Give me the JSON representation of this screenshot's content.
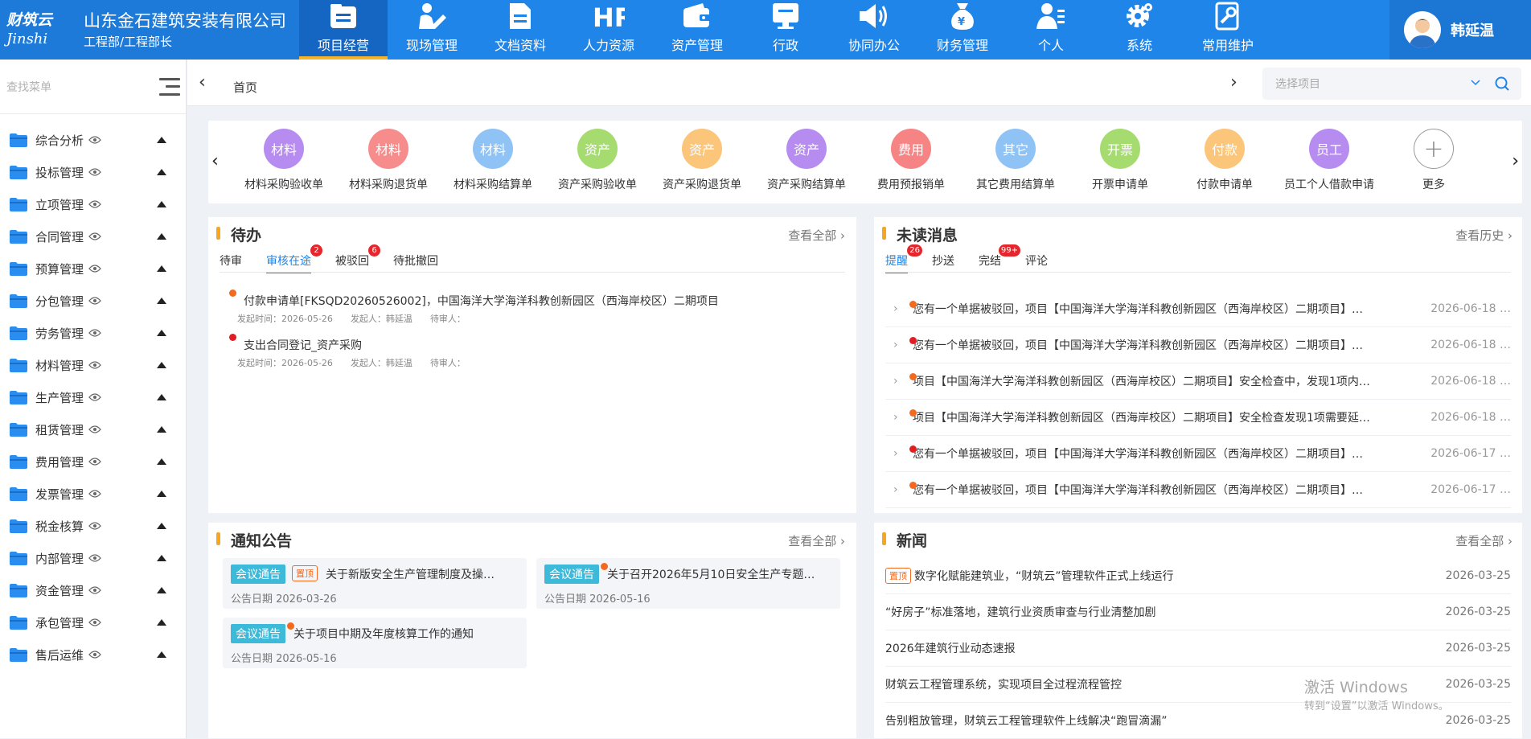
{
  "brand": {
    "logo_line1": "财筑云",
    "logo_line2": "Jinshi",
    "company": "山东金石建筑安装有限公司",
    "role": "工程部/工程部长"
  },
  "nav": [
    {
      "label": "项目经营",
      "icon": "project-icon",
      "active": true
    },
    {
      "label": "现场管理",
      "icon": "site-worker-icon"
    },
    {
      "label": "文档资料",
      "icon": "document-icon"
    },
    {
      "label": "人力资源",
      "icon": "hr-icon"
    },
    {
      "label": "资产管理",
      "icon": "wallet-icon"
    },
    {
      "label": "行政",
      "icon": "monitor-icon"
    },
    {
      "label": "协同办公",
      "icon": "speaker-icon"
    },
    {
      "label": "财务管理",
      "icon": "money-bag-icon"
    },
    {
      "label": "个人",
      "icon": "person-icon"
    },
    {
      "label": "系统",
      "icon": "gear-icon"
    },
    {
      "label": "常用维护",
      "icon": "maintenance-icon"
    }
  ],
  "user": {
    "name": "韩延温"
  },
  "sidebar": {
    "search_placeholder": "查找菜单",
    "items": [
      {
        "label": "综合分析"
      },
      {
        "label": "投标管理"
      },
      {
        "label": "立项管理"
      },
      {
        "label": "合同管理"
      },
      {
        "label": "预算管理"
      },
      {
        "label": "分包管理"
      },
      {
        "label": "劳务管理"
      },
      {
        "label": "材料管理"
      },
      {
        "label": "生产管理"
      },
      {
        "label": "租赁管理"
      },
      {
        "label": "费用管理"
      },
      {
        "label": "发票管理"
      },
      {
        "label": "税金核算"
      },
      {
        "label": "内部管理"
      },
      {
        "label": "资金管理"
      },
      {
        "label": "承包管理"
      },
      {
        "label": "售后运维"
      }
    ]
  },
  "breadcrumb": {
    "home": "首页",
    "project_placeholder": "选择项目"
  },
  "quick": [
    {
      "circle": "材料",
      "label": "材料采购验收单",
      "color": "#b78cf0"
    },
    {
      "circle": "材料",
      "label": "材料采购退货单",
      "color": "#f78c8c"
    },
    {
      "circle": "材料",
      "label": "材料采购结算单",
      "color": "#8fc3f5"
    },
    {
      "circle": "资产",
      "label": "资产采购验收单",
      "color": "#a6dc6f"
    },
    {
      "circle": "资产",
      "label": "资产采购退货单",
      "color": "#fbc57a"
    },
    {
      "circle": "资产",
      "label": "资产采购结算单",
      "color": "#b78cf0"
    },
    {
      "circle": "费用",
      "label": "费用预报销单",
      "color": "#f78484"
    },
    {
      "circle": "其它",
      "label": "其它费用结算单",
      "color": "#8fc3f5"
    },
    {
      "circle": "开票",
      "label": "开票申请单",
      "color": "#a6dc6f"
    },
    {
      "circle": "付款",
      "label": "付款申请单",
      "color": "#fbc57a"
    },
    {
      "circle": "员工",
      "label": "员工个人借款申请",
      "color": "#b78cf0"
    },
    {
      "circle": "+",
      "label": "更多",
      "color": "#ffffff"
    }
  ],
  "todo": {
    "title": "待办",
    "view_all": "查看全部",
    "tabs": [
      {
        "label": "待审"
      },
      {
        "label": "审核在途",
        "badge": "2",
        "active": true
      },
      {
        "label": "被驳回",
        "badge": "6"
      },
      {
        "label": "待批撤回"
      }
    ],
    "items": [
      {
        "title": "付款申请单[FKSQD20260526002]，中国海洋大学海洋科教创新园区（西海岸校区）二期项目",
        "time": "发起时间：2026-05-26",
        "initiator": "发起人：韩延温",
        "approver": "待审人：",
        "dot": "orange"
      },
      {
        "title": "支出合同登记_资产采购",
        "time": "发起时间：2026-05-26",
        "initiator": "发起人：韩延温",
        "approver": "待审人：",
        "dot": "red"
      }
    ]
  },
  "messages": {
    "title": "未读消息",
    "view_all": "查看历史",
    "tabs": [
      {
        "label": "提醒",
        "badge": "26",
        "active": true
      },
      {
        "label": "抄送"
      },
      {
        "label": "完结",
        "badge": "99+"
      },
      {
        "label": "评论"
      }
    ],
    "items": [
      {
        "text": "您有一个单据被驳回，项目【中国海洋大学海洋科教创新园区（西海岸校区）二期项目】…",
        "date": "2026-06-18 …",
        "dot": "orange"
      },
      {
        "text": "您有一个单据被驳回，项目【中国海洋大学海洋科教创新园区（西海岸校区）二期项目】…",
        "date": "2026-06-18 …",
        "dot": "red"
      },
      {
        "text": "项目【中国海洋大学海洋科教创新园区（西海岸校区）二期项目】安全检查中，发现1项内…",
        "date": "2026-06-18 …",
        "dot": "orange"
      },
      {
        "text": "项目【中国海洋大学海洋科教创新园区（西海岸校区）二期项目】安全检查发现1项需要延…",
        "date": "2026-06-18 …",
        "dot": "orange"
      },
      {
        "text": "您有一个单据被驳回，项目【中国海洋大学海洋科教创新园区（西海岸校区）二期项目】…",
        "date": "2026-06-17 …",
        "dot": "red"
      },
      {
        "text": "您有一个单据被驳回，项目【中国海洋大学海洋科教创新园区（西海岸校区）二期项目】…",
        "date": "2026-06-17 …",
        "dot": "orange"
      }
    ]
  },
  "notices": {
    "title": "通知公告",
    "view_all": "查看全部",
    "items": [
      {
        "tag": "会议通告",
        "top": "置顶",
        "title": "关于新版安全生产管理制度及操…",
        "date": "公告日期 2026-03-26"
      },
      {
        "tag": "会议通告",
        "title": "关于召开2026年5月10日安全生产专题…",
        "date": "公告日期 2026-05-16"
      },
      {
        "tag": "会议通告",
        "title": "关于项目中期及年度核算工作的通知",
        "date": "公告日期 2026-05-16"
      }
    ]
  },
  "news": {
    "title": "新闻",
    "view_all": "查看全部",
    "items": [
      {
        "top": "置顶",
        "title": "数字化赋能建筑业，“财筑云”管理软件正式上线运行",
        "date": "2026-03-25"
      },
      {
        "title": "“好房子”标准落地，建筑行业资质审查与行业清整加剧",
        "date": "2026-03-25"
      },
      {
        "title": "2026年建筑行业动态速报",
        "date": "2026-03-25"
      },
      {
        "title": "财筑云工程管理系统，实现项目全过程流程管控",
        "date": "2026-03-25"
      },
      {
        "title": "告别粗放管理，财筑云工程管理软件上线解决“跑冒滴漏”",
        "date": "2026-03-25"
      }
    ]
  },
  "watermark": {
    "line1": "激活 Windows",
    "line2": "转到“设置”以激活 Windows。"
  }
}
